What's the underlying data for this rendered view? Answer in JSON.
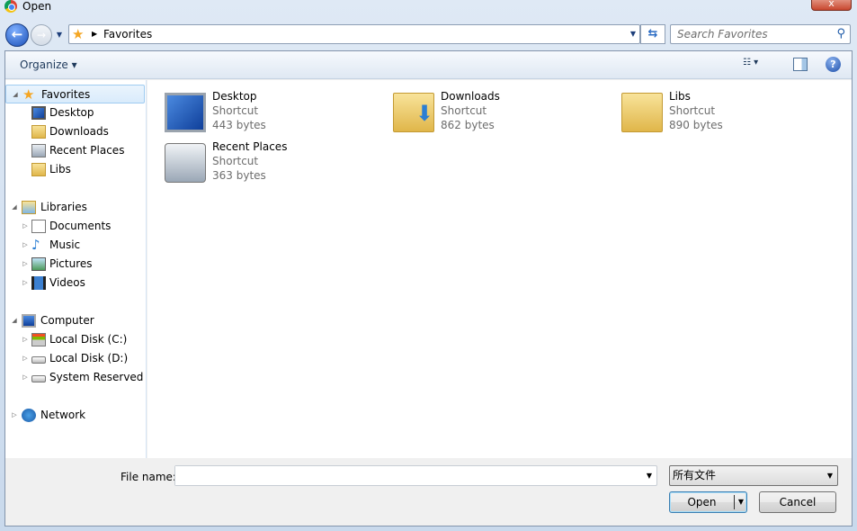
{
  "window": {
    "title": "Open",
    "close_label": "x"
  },
  "nav": {
    "back_label": "←",
    "forward_label": "→",
    "history_label": "▼"
  },
  "address": {
    "path": "Favorites",
    "separator": "▶",
    "refresh_label": "⇆"
  },
  "search": {
    "placeholder": "Search Favorites",
    "value": ""
  },
  "toolbar": {
    "organize_label": "Organize ▾",
    "views_label": "☷ ▾",
    "help_label": "?"
  },
  "sidebar": {
    "groups": [
      {
        "label": "Favorites",
        "icon": "star-icon",
        "expanded": true,
        "selected": true,
        "items": [
          {
            "label": "Desktop",
            "icon": "desktop-icon"
          },
          {
            "label": "Downloads",
            "icon": "downloads-folder-icon"
          },
          {
            "label": "Recent Places",
            "icon": "recent-places-icon"
          },
          {
            "label": "Libs",
            "icon": "folder-icon"
          }
        ]
      },
      {
        "label": "Libraries",
        "icon": "libraries-icon",
        "expanded": true,
        "items": [
          {
            "label": "Documents",
            "icon": "documents-icon"
          },
          {
            "label": "Music",
            "icon": "music-icon"
          },
          {
            "label": "Pictures",
            "icon": "pictures-icon"
          },
          {
            "label": "Videos",
            "icon": "videos-icon"
          }
        ]
      },
      {
        "label": "Computer",
        "icon": "computer-icon",
        "expanded": true,
        "items": [
          {
            "label": "Local Disk (C:)",
            "icon": "system-drive-icon"
          },
          {
            "label": "Local Disk (D:)",
            "icon": "drive-icon"
          },
          {
            "label": "System Reserved (G:",
            "icon": "drive-icon"
          }
        ]
      },
      {
        "label": "Network",
        "icon": "network-icon",
        "expanded": false,
        "items": []
      }
    ]
  },
  "files": [
    {
      "name": "Desktop",
      "type": "Shortcut",
      "size": "443 bytes",
      "icon": "desktop-icon"
    },
    {
      "name": "Downloads",
      "type": "Shortcut",
      "size": "862 bytes",
      "icon": "downloads-folder-icon"
    },
    {
      "name": "Libs",
      "type": "Shortcut",
      "size": "890 bytes",
      "icon": "folder-icon"
    },
    {
      "name": "Recent Places",
      "type": "Shortcut",
      "size": "363 bytes",
      "icon": "recent-places-icon"
    }
  ],
  "footer": {
    "file_name_label": "File name:",
    "file_name_value": "",
    "file_type": "所有文件",
    "open_label": "Open",
    "cancel_label": "Cancel"
  }
}
